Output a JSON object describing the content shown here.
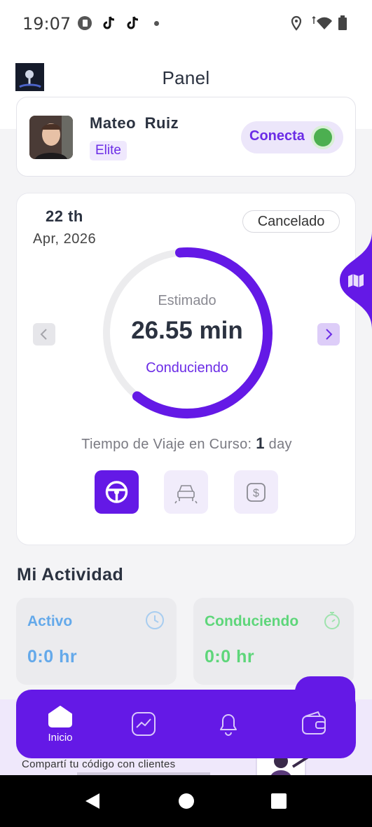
{
  "status_bar": {
    "time": "19:07"
  },
  "header": {
    "title": "Panel"
  },
  "profile": {
    "name": "Mateo  Ruiz",
    "tier": "Elite",
    "connect_label": "Conecta"
  },
  "trip": {
    "day": "22 th",
    "month_year": "Apr, 2026",
    "status": "Cancelado",
    "gauge_caption": "Estimado",
    "gauge_value": "26.55 min",
    "gauge_state": "Conduciendo",
    "gauge_progress": 0.62,
    "travel_time_label": "Tiempo de Viaje en Curso:",
    "travel_time_value": "1",
    "travel_time_unit": "day",
    "modes": [
      "steering-wheel-icon",
      "car-icon",
      "dollar-icon"
    ]
  },
  "activity": {
    "title": "Mi Actividad",
    "cards": [
      {
        "label": "Activo",
        "value": "0:0 hr",
        "color": "#64a9ea",
        "icon": "clock-icon"
      },
      {
        "label": "Conduciendo",
        "value": "0:0 hr",
        "color": "#5ed67a",
        "icon": "stopwatch-icon"
      }
    ]
  },
  "promo": {
    "text": "Compartí tu código con clientes"
  },
  "bottom_nav": {
    "items": [
      {
        "label": "Inicio",
        "icon": "home-icon"
      },
      {
        "label": "",
        "icon": "chart-icon"
      },
      {
        "label": "",
        "icon": "bell-icon"
      },
      {
        "label": "",
        "icon": "wallet-icon"
      }
    ]
  },
  "colors": {
    "accent": "#6419e6",
    "online": "#4caf50"
  }
}
